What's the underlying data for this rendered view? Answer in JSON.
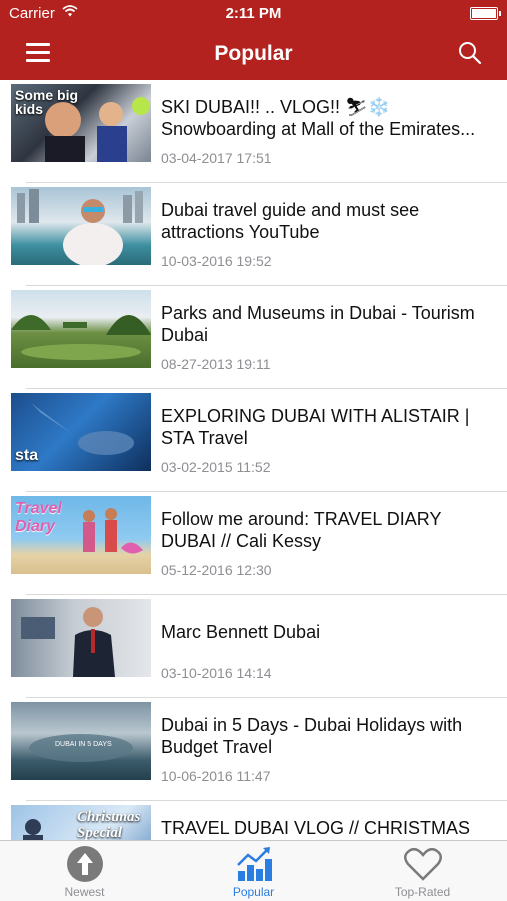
{
  "status_bar": {
    "carrier": "Carrier",
    "time": "2:11 PM"
  },
  "navbar": {
    "title": "Popular"
  },
  "thumb_text": {
    "video1": "Some big kids",
    "video4": "sta",
    "video5": "Travel Diary",
    "video8": "Christmas Special"
  },
  "videos": [
    {
      "title": "SKI DUBAI!! .. VLOG!! ⛷❄️ Snowboarding at Mall of the Emirates...",
      "date": "03-04-2017 17:51"
    },
    {
      "title": "Dubai travel guide and must see attractions   YouTube",
      "date": "10-03-2016 19:52"
    },
    {
      "title": "Parks and Museums in Dubai - Tourism Dubai",
      "date": "08-27-2013 19:11"
    },
    {
      "title": "EXPLORING DUBAI WITH ALISTAIR | STA Travel",
      "date": "03-02-2015 11:52"
    },
    {
      "title": "Follow me around: TRAVEL DIARY DUBAI // Cali Kessy",
      "date": "05-12-2016 12:30"
    },
    {
      "title": "Marc Bennett Dubai",
      "date": "03-10-2016 14:14"
    },
    {
      "title": "Dubai in 5 Days - Dubai Holidays with Budget Travel",
      "date": "10-06-2016 11:47"
    },
    {
      "title": "TRAVEL DUBAI VLOG // CHRISTMAS",
      "date": ""
    }
  ],
  "tabs": [
    {
      "label": "Newest",
      "icon": "arrow-up-circle-icon"
    },
    {
      "label": "Popular",
      "icon": "trending-chart-icon"
    },
    {
      "label": "Top-Rated",
      "icon": "heart-icon"
    }
  ],
  "colors": {
    "nav_background": "#b3221e",
    "tab_active": "#2a7de1",
    "tab_inactive": "#8e8e93"
  }
}
